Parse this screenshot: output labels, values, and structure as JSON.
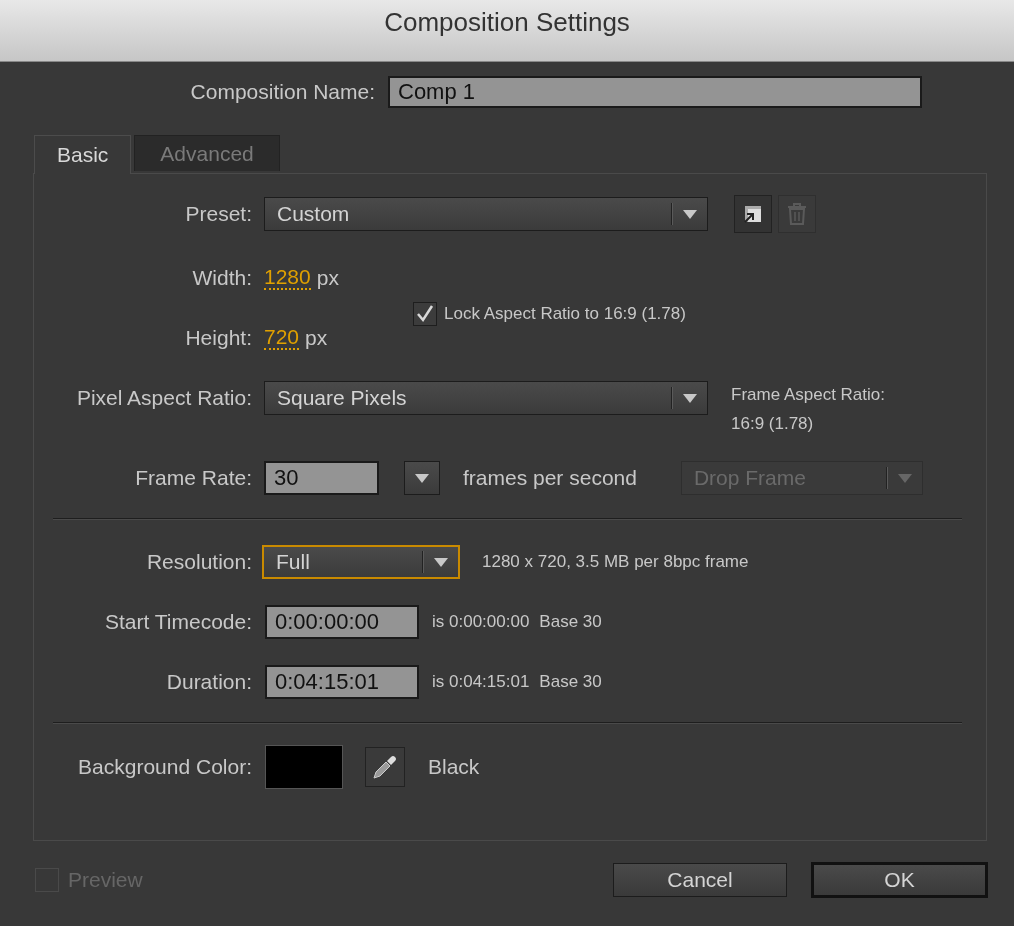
{
  "window": {
    "title": "Composition Settings"
  },
  "composition_name": {
    "label": "Composition Name:",
    "value": "Comp 1"
  },
  "tabs": [
    {
      "label": "Basic",
      "selected": true
    },
    {
      "label": "Advanced",
      "selected": false
    }
  ],
  "preset": {
    "label": "Preset:",
    "value": "Custom"
  },
  "width": {
    "label": "Width:",
    "value": "1280",
    "unit": "px"
  },
  "height": {
    "label": "Height:",
    "value": "720",
    "unit": "px"
  },
  "lock_aspect_ratio": {
    "label": "Lock Aspect Ratio to 16:9 (1.78)",
    "checked": true
  },
  "pixel_aspect_ratio": {
    "label": "Pixel Aspect Ratio:",
    "value": "Square Pixels"
  },
  "frame_aspect_ratio": {
    "label": "Frame Aspect Ratio:",
    "value": "16:9 (1.78)"
  },
  "frame_rate": {
    "label": "Frame Rate:",
    "value": "30",
    "unit": "frames per second"
  },
  "drop_frame": {
    "value": "Drop Frame",
    "disabled": true
  },
  "resolution": {
    "label": "Resolution:",
    "value": "Full",
    "focused": true,
    "info": "1280 x 720, 3.5 MB per 8bpc frame"
  },
  "start_timecode": {
    "label": "Start Timecode:",
    "value": "0:00:00:00",
    "info": "is 0:00:00:00",
    "base": "Base 30"
  },
  "duration": {
    "label": "Duration:",
    "value": "0:04:15:01",
    "info": "is 0:04:15:01",
    "base": "Base 30"
  },
  "background_color": {
    "label": "Background Color:",
    "color": "#000000",
    "name": "Black"
  },
  "preview": {
    "label": "Preview",
    "checked": false,
    "disabled": true
  },
  "buttons": [
    {
      "label": "Cancel",
      "default": false
    },
    {
      "label": "OK",
      "default": true
    }
  ]
}
